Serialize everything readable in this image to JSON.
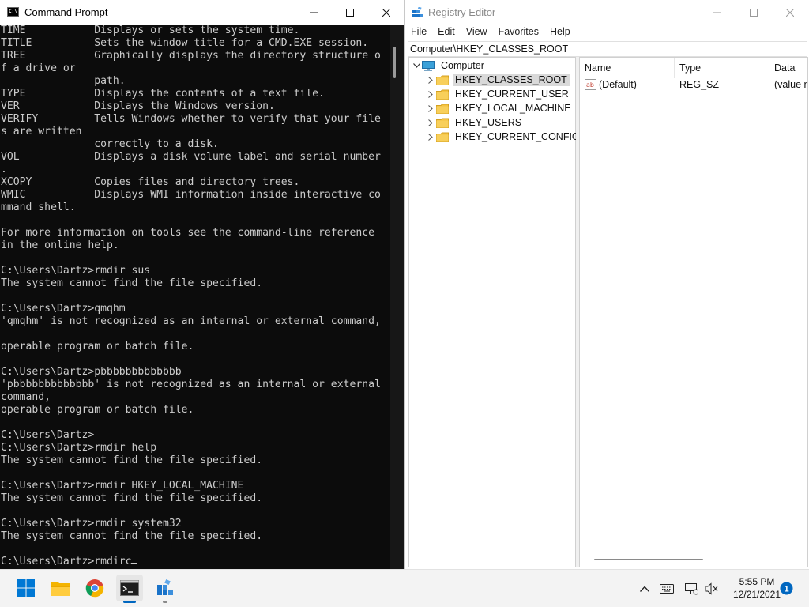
{
  "cmd": {
    "title": "Command Prompt",
    "lines": [
      "TIME           Displays or sets the system time.",
      "TITLE          Sets the window title for a CMD.EXE session.",
      "TREE           Graphically displays the directory structure o",
      "f a drive or",
      "               path.",
      "TYPE           Displays the contents of a text file.",
      "VER            Displays the Windows version.",
      "VERIFY         Tells Windows whether to verify that your file",
      "s are written",
      "               correctly to a disk.",
      "VOL            Displays a disk volume label and serial number",
      ".",
      "XCOPY          Copies files and directory trees.",
      "WMIC           Displays WMI information inside interactive co",
      "mmand shell.",
      "",
      "For more information on tools see the command-line reference",
      "in the online help.",
      "",
      "C:\\Users\\Dartz>rmdir sus",
      "The system cannot find the file specified.",
      "",
      "C:\\Users\\Dartz>qmqhm",
      "'qmqhm' is not recognized as an internal or external command,",
      "",
      "operable program or batch file.",
      "",
      "C:\\Users\\Dartz>pbbbbbbbbbbbbb",
      "'pbbbbbbbbbbbbb' is not recognized as an internal or external",
      "command,",
      "operable program or batch file.",
      "",
      "C:\\Users\\Dartz>",
      "C:\\Users\\Dartz>rmdir help",
      "The system cannot find the file specified.",
      "",
      "C:\\Users\\Dartz>rmdir HKEY_LOCAL_MACHINE",
      "The system cannot find the file specified.",
      "",
      "C:\\Users\\Dartz>rmdir system32",
      "The system cannot find the file specified.",
      ""
    ],
    "prompt_line": "C:\\Users\\Dartz>rmdirc"
  },
  "regedit": {
    "title": "Registry Editor",
    "menu": [
      "File",
      "Edit",
      "View",
      "Favorites",
      "Help"
    ],
    "address": "Computer\\HKEY_CLASSES_ROOT",
    "tree_root": "Computer",
    "tree_items": [
      "HKEY_CLASSES_ROOT",
      "HKEY_CURRENT_USER",
      "HKEY_LOCAL_MACHINE",
      "HKEY_USERS",
      "HKEY_CURRENT_CONFIG"
    ],
    "selected_key": "HKEY_CLASSES_ROOT",
    "columns": [
      "Name",
      "Type",
      "Data"
    ],
    "values": [
      {
        "name": "(Default)",
        "type": "REG_SZ",
        "data": "(value not set)"
      }
    ]
  },
  "taskbar": {
    "apps": [
      "start-icon",
      "file-explorer-icon",
      "chrome-icon",
      "terminal-icon",
      "registry-editor-icon"
    ],
    "time": "5:55 PM",
    "date": "12/21/2021",
    "notification_count": "1"
  },
  "colors": {
    "console_bg": "#0c0c0c",
    "console_text": "#cccccc",
    "accent_blue": "#0067c0",
    "folder_yellow": "#f5c342"
  }
}
